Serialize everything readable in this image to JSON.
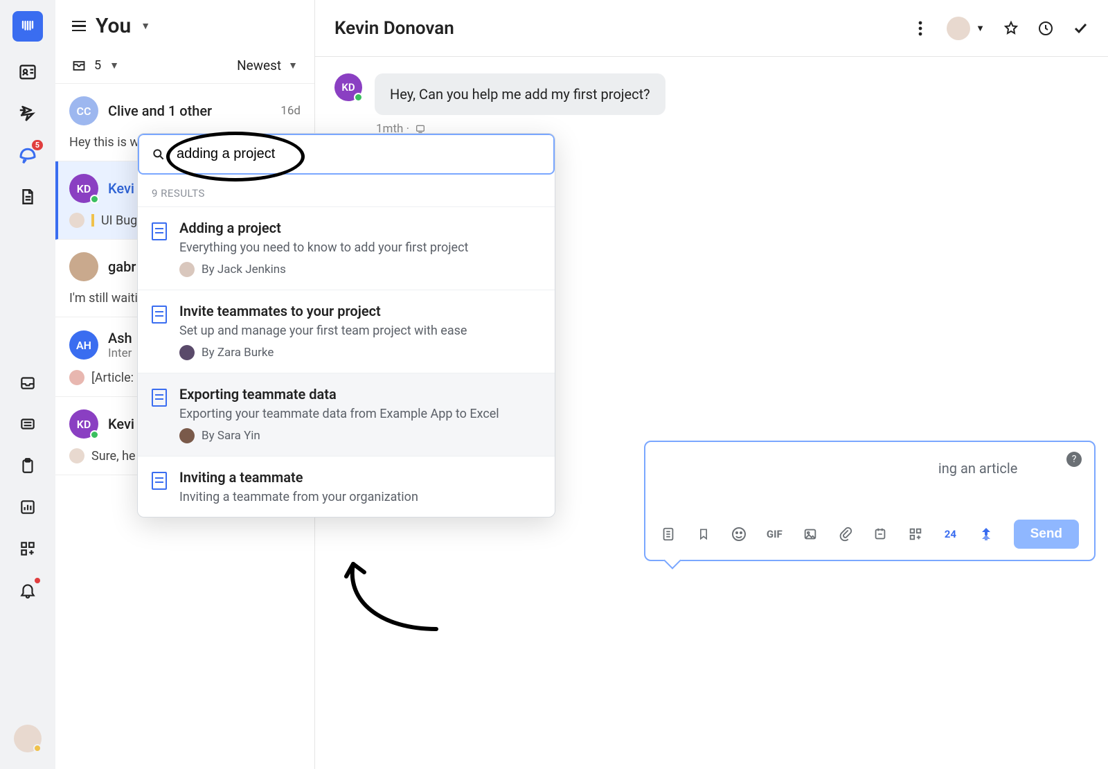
{
  "app": {
    "name": "Intercom"
  },
  "rail": {
    "badge_count": "5"
  },
  "inbox": {
    "title": "You",
    "count": "5",
    "sort_label": "Newest",
    "items": [
      {
        "initials": "CC",
        "color": "#9db7ef",
        "name": "Clive and 1 other",
        "time": "16d",
        "preview": "Hey this is w",
        "presence": false
      },
      {
        "initials": "KD",
        "color": "#8a3fc2",
        "name": "Kevi",
        "time": "",
        "preview": "UI Bug",
        "presence": true,
        "selected": true,
        "tag": true
      },
      {
        "initials": "",
        "color": "#c9a98d",
        "name": "gabr",
        "time": "",
        "preview": "I'm still waiti",
        "presence": false,
        "photo": true
      },
      {
        "initials": "AH",
        "color": "#3a6df0",
        "name": "Ash",
        "time": "",
        "subtitle": "Inter",
        "preview": "[Article:",
        "presence": false
      },
      {
        "initials": "KD",
        "color": "#8a3fc2",
        "name": "Kevi",
        "time": "",
        "preview": "Sure, he",
        "presence": true
      }
    ]
  },
  "panel": {
    "title": "Kevin Donovan",
    "message": {
      "initials": "KD",
      "text": "Hey, Can you help me add my first project?",
      "meta": "1mth ·"
    }
  },
  "search": {
    "query": "adding a project",
    "results_label": "9 RESULTS",
    "results": [
      {
        "title": "Adding a project",
        "desc": "Everything you need to know to add your first project",
        "author": "By Jack Jenkins"
      },
      {
        "title": "Invite teammates to your project",
        "desc": "Set up and manage your first team project with ease",
        "author": "By Zara Burke"
      },
      {
        "title": "Exporting teammate data",
        "desc": "Exporting your teammate data from Example App to Excel",
        "author": "By Sara Yin",
        "hover": true
      },
      {
        "title": "Inviting a teammate",
        "desc": "Inviting a teammate from your organization",
        "author": ""
      }
    ]
  },
  "composer": {
    "hint_suffix": "ing an article",
    "gif_label": "GIF",
    "sessions_label": "24",
    "send_label": "Send",
    "help_label": "?"
  }
}
